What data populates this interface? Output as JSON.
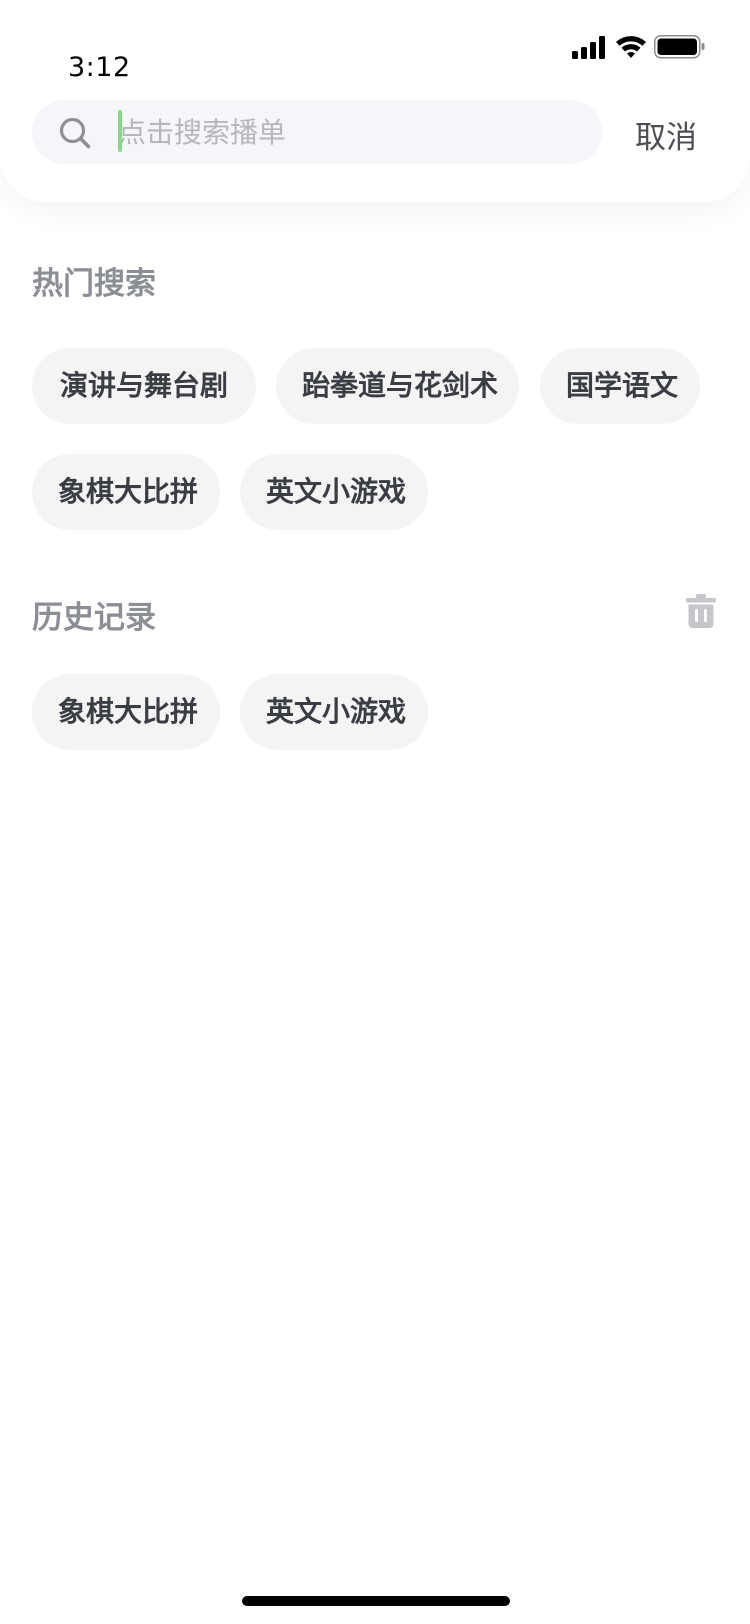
{
  "status_bar": {
    "time": "3:12",
    "icons": [
      "cellular-signal-icon",
      "wifi-icon",
      "battery-icon"
    ]
  },
  "search": {
    "placeholder": "点击搜索播单",
    "value": "",
    "cancel_label": "取消"
  },
  "hot_search": {
    "title": "热门搜索",
    "items": [
      "演讲与舞台剧",
      "跆拳道与花剑术",
      "国学语文",
      "象棋大比拼",
      "英文小游戏"
    ]
  },
  "history": {
    "title": "历史记录",
    "clear_icon": "trash-icon",
    "items": [
      "象棋大比拼",
      "英文小游戏"
    ]
  },
  "colors": {
    "caret": "#8ad58a",
    "chip_background": "#f4f4f5",
    "section_title": "#8b8e94",
    "search_background": "#f5f6f9"
  }
}
